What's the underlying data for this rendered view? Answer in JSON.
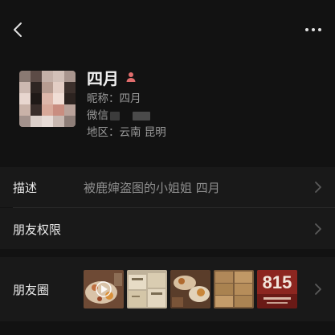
{
  "header": {
    "back_icon": "chevron-left-icon",
    "more_icon": "more-horizontal-icon"
  },
  "profile": {
    "name": "四月",
    "gender_icon": "female-person-icon",
    "gender_color": "#e06c6c",
    "nickname_label": "昵称：",
    "nickname_value": "四月",
    "wechat_label": "微信",
    "region_label": "地区：",
    "region_value": "云南  昆明"
  },
  "rows": {
    "description": {
      "label": "描述",
      "value": "被鹿婶盗图的小姐姐 四月"
    },
    "permissions": {
      "label": "朋友权限"
    },
    "moments": {
      "label": "朋友圈",
      "photo_count": 5
    }
  },
  "colors": {
    "background": "#121212",
    "row_background": "#191919",
    "text_primary": "#ececec",
    "text_secondary": "#8f8f8f"
  }
}
